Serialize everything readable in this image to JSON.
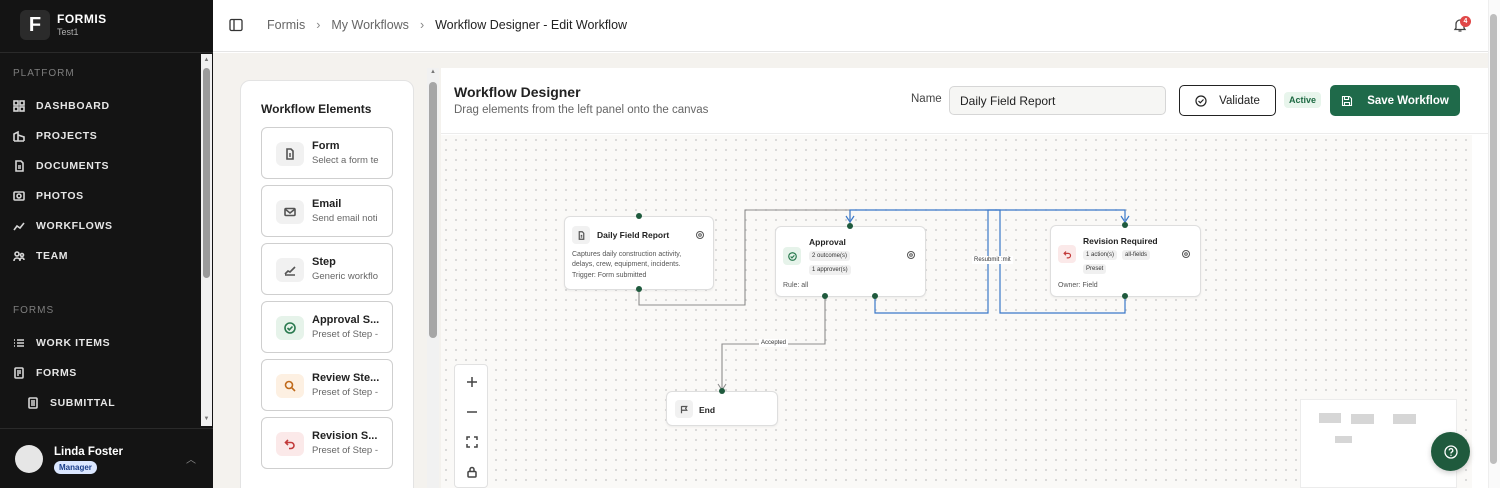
{
  "brand": {
    "name": "FORMIS",
    "workspace": "Test1",
    "logo_letter": "F"
  },
  "sidebar": {
    "platform_label": "PLATFORM",
    "platform_items": [
      {
        "label": "DASHBOARD",
        "icon": "dashboard-icon"
      },
      {
        "label": "PROJECTS",
        "icon": "projects-icon"
      },
      {
        "label": "DOCUMENTS",
        "icon": "documents-icon"
      },
      {
        "label": "PHOTOS",
        "icon": "photos-icon"
      },
      {
        "label": "WORKFLOWS",
        "icon": "workflows-icon"
      },
      {
        "label": "TEAM",
        "icon": "team-icon"
      }
    ],
    "forms_label": "FORMS",
    "forms_items": [
      {
        "label": "WORK ITEMS",
        "icon": "work-items-icon"
      },
      {
        "label": "FORMS",
        "icon": "forms-icon"
      },
      {
        "label": "SUBMITTAL",
        "icon": "submittal-icon"
      }
    ]
  },
  "user": {
    "name": "Linda Foster",
    "role": "Manager"
  },
  "header": {
    "breadcrumbs": [
      "Formis",
      "My Workflows",
      "Workflow Designer - Edit Workflow"
    ],
    "notification_count": "4"
  },
  "elements_panel": {
    "title": "Workflow Elements",
    "items": [
      {
        "name": "Form",
        "desc": "Select a form te",
        "icon": "form-icon"
      },
      {
        "name": "Email",
        "desc": "Send email noti",
        "icon": "email-icon"
      },
      {
        "name": "Step",
        "desc": "Generic workflo",
        "icon": "step-icon"
      },
      {
        "name": "Approval S...",
        "desc": "Preset of Step -",
        "icon": "approval-icon"
      },
      {
        "name": "Review Ste...",
        "desc": "Preset of Step -",
        "icon": "review-icon"
      },
      {
        "name": "Revision S...",
        "desc": "Preset of Step -",
        "icon": "revision-icon"
      }
    ]
  },
  "designer": {
    "title": "Workflow Designer",
    "subtitle": "Drag elements from the left panel onto the canvas",
    "name_label": "Name",
    "name_value": "Daily Field Report",
    "validate_label": "Validate",
    "status": "Active",
    "save_label": "Save Workflow"
  },
  "nodes": {
    "daily": {
      "title": "Daily Field Report",
      "desc_1": "Captures daily construction activity,",
      "desc_2": "delays, crew, equipment, incidents.",
      "trigger": "Trigger: Form submitted"
    },
    "approval": {
      "title": "Approval",
      "chip_1": "2 outcome(s)",
      "chip_2": "1 approver(s)",
      "rule": "Rule: all"
    },
    "revision": {
      "title": "Revision Required",
      "chip_1": "1 action(s)",
      "chip_2": "all-fields",
      "chip_3": "Preset",
      "owner": "Owner: Field"
    },
    "end": {
      "title": "End"
    }
  },
  "edges": {
    "accepted": "Accepted",
    "resubmit": "Resubmit :mit"
  },
  "colors": {
    "brand_green": "#1f6a4a",
    "sidebar_bg": "#141414",
    "edge_blue": "#3a78c9"
  }
}
